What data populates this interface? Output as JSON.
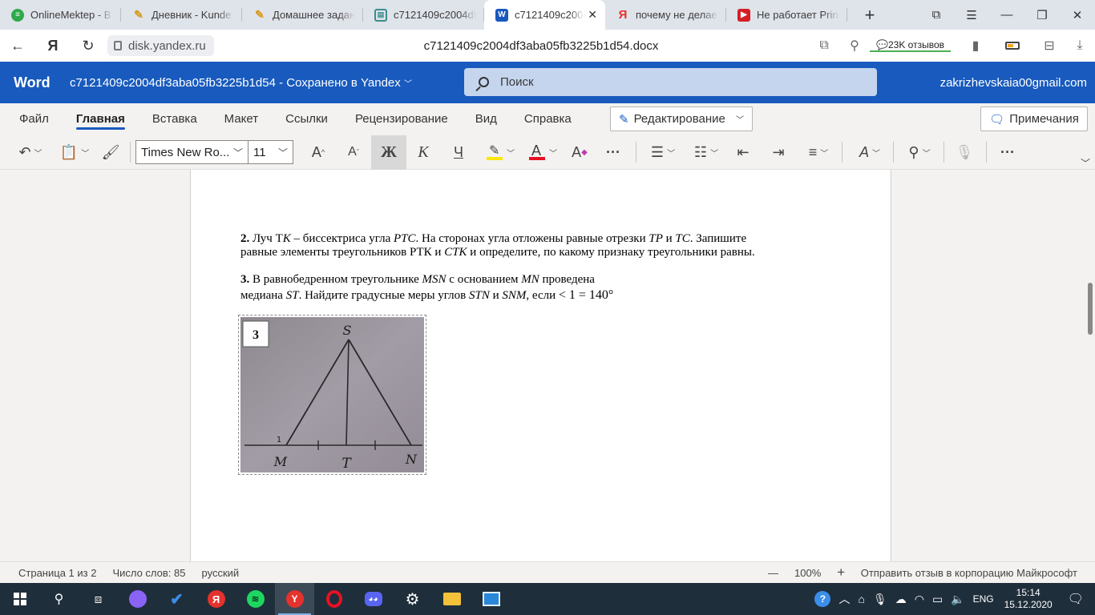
{
  "browser": {
    "tabs": [
      {
        "title": "OnlineMektep - В",
        "icon": "onlinemektep-icon",
        "color": "#2eaa4a",
        "glyph": "≡",
        "active": false
      },
      {
        "title": "Дневник - Kunde",
        "icon": "kundelik-icon",
        "color": "#f2b52c",
        "glyph": "✎",
        "active": false
      },
      {
        "title": "Домашнее задан",
        "icon": "kundelik-icon",
        "color": "#f2b52c",
        "glyph": "✎",
        "active": false
      },
      {
        "title": "c7121409c2004df",
        "icon": "document-icon",
        "color": "#3a8e8e",
        "glyph": "▤",
        "active": false
      },
      {
        "title": "c7121409c2004",
        "icon": "word-icon",
        "color": "#185abd",
        "glyph": "W",
        "active": true
      },
      {
        "title": "почему не делае",
        "icon": "yandex-icon",
        "color": "#e5322d",
        "glyph": "Я",
        "active": false
      },
      {
        "title": "Не работает Print",
        "icon": "video-icon",
        "color": "#d41f26",
        "glyph": "▶",
        "active": false
      }
    ],
    "domain": "disk.yandex.ru",
    "page_title": "c7121409c2004df3aba05fb3225b1d54.docx",
    "reviews": "23K отзывов"
  },
  "word": {
    "brand": "Word",
    "doc_title": "c7121409c2004df3aba05fb3225b1d54",
    "doc_status": " - Сохранено в Yandex",
    "search_placeholder": "Поиск",
    "user_email": "zakrizhevskaia00gmail.com",
    "ribbon_tabs": [
      "Файл",
      "Главная",
      "Вставка",
      "Макет",
      "Ссылки",
      "Рецензирование",
      "Вид",
      "Справка"
    ],
    "active_tab": "Главная",
    "edit_mode": "Редактирование",
    "comments": "Примечания",
    "font_name": "Times New Ro...",
    "font_size": "11",
    "bold": "Ж",
    "italic": "К",
    "underline": "Ч",
    "highlight_color": "#ffe600",
    "font_color": "#e81123"
  },
  "document": {
    "task2": {
      "num": "2.",
      "l1_a": " Луч Т",
      "l1_b": "K",
      "l1_c": " – биссектриса угла ",
      "l1_d": "PTC",
      "l1_e": ". На сторонах угла отложены   равные отрезки ",
      "l1_f": "TP",
      "l1_g": " и ",
      "l1_h": "TC",
      "l1_i": ". Запишите",
      "l2_a": "равные элементы треугольников РТК и ",
      "l2_b": "CTK",
      "l2_c": " и определите, по какому признаку треугольники равны."
    },
    "task3": {
      "num": "3.",
      "l1_a": " В равнобедренном треугольнике ",
      "l1_b": "MSN",
      "l1_c": " с основанием ",
      "l1_d": "MN",
      "l1_e": " проведена",
      "l2_a": " медиана ",
      "l2_b": "ST",
      "l2_c": ". Найдите градусные меры углов ",
      "l2_d": "STN",
      "l2_e": " и ",
      "l2_f": "SNM",
      "l2_g": ", если ",
      "l2_h": "< 1 = 140°"
    },
    "figure": {
      "label": "3",
      "vertex_s": "S",
      "vertex_m": "M",
      "vertex_t": "T",
      "vertex_n": "N",
      "angle_mark": "1"
    }
  },
  "status": {
    "page": "Страница 1 из 2",
    "words": "Число слов: 85",
    "language": "русский",
    "zoom_minus": "—",
    "zoom": "100%",
    "zoom_plus": "+",
    "feedback": "Отправить отзыв в корпорацию Майкрософт"
  },
  "taskbar": {
    "language": "ENG",
    "time": "15:14",
    "date": "15.12.2020"
  }
}
